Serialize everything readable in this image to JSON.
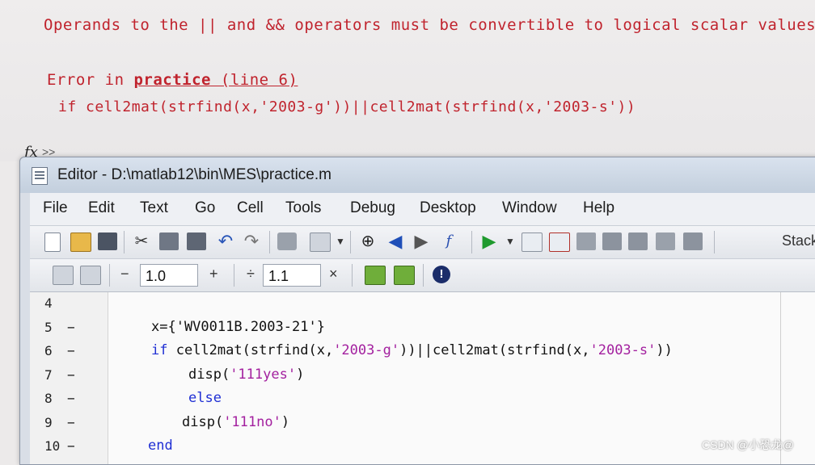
{
  "command_window": {
    "error_message": "Operands to the || and && operators must be convertible to logical scalar values.",
    "error_prefix": "Error in ",
    "error_link": "practice",
    "error_location": " (line 6)",
    "error_code": "if cell2mat(strfind(x,'2003-g'))||cell2mat(strfind(x,'2003-s'))",
    "prompt_symbol": "fx",
    "prompt_arrows": ">>"
  },
  "editor": {
    "title": "Editor - D:\\matlab12\\bin\\MES\\practice.m",
    "menu": [
      "File",
      "Edit",
      "Text",
      "Go",
      "Cell",
      "Tools",
      "Debug",
      "Desktop",
      "Window",
      "Help"
    ],
    "toolbar": {
      "stack_label": "Stack",
      "minus_label": "−",
      "step_value_1": "1.0",
      "plus_label": "+",
      "divide_label": "÷",
      "step_value_2": "1.1",
      "times_label": "×"
    },
    "code_lines": [
      {
        "number": "4",
        "dash": "",
        "parts": []
      },
      {
        "number": "5",
        "dash": "−",
        "parts": [
          {
            "t": "x={'WV0011B.2003-21'}",
            "c": "plain"
          }
        ]
      },
      {
        "number": "6",
        "dash": "−",
        "parts": [
          {
            "t": "if",
            "c": "kw"
          },
          {
            "t": " cell2mat(strfind(x,",
            "c": "plain"
          },
          {
            "t": "'2003-g'",
            "c": "str"
          },
          {
            "t": "))||cell2mat(strfind(x,",
            "c": "plain"
          },
          {
            "t": "'2003-s'",
            "c": "str"
          },
          {
            "t": "))",
            "c": "plain"
          }
        ]
      },
      {
        "number": "7",
        "dash": "−",
        "parts": [
          {
            "t": "disp(",
            "c": "plain"
          },
          {
            "t": "'111yes'",
            "c": "str"
          },
          {
            "t": ")",
            "c": "plain"
          }
        ]
      },
      {
        "number": "8",
        "dash": "−",
        "parts": [
          {
            "t": "else",
            "c": "kw"
          }
        ]
      },
      {
        "number": "9",
        "dash": "−",
        "parts": [
          {
            "t": "disp(",
            "c": "plain"
          },
          {
            "t": "'111no'",
            "c": "str"
          },
          {
            "t": ")",
            "c": "plain"
          }
        ]
      },
      {
        "number": "10",
        "dash": "−",
        "parts": [
          {
            "t": "end",
            "c": "kw"
          }
        ]
      }
    ]
  },
  "watermark": "CSDN @小恐龙@",
  "colors": {
    "error": "#c0232d",
    "keyword": "#1f2fd4",
    "string": "#a3209f"
  }
}
